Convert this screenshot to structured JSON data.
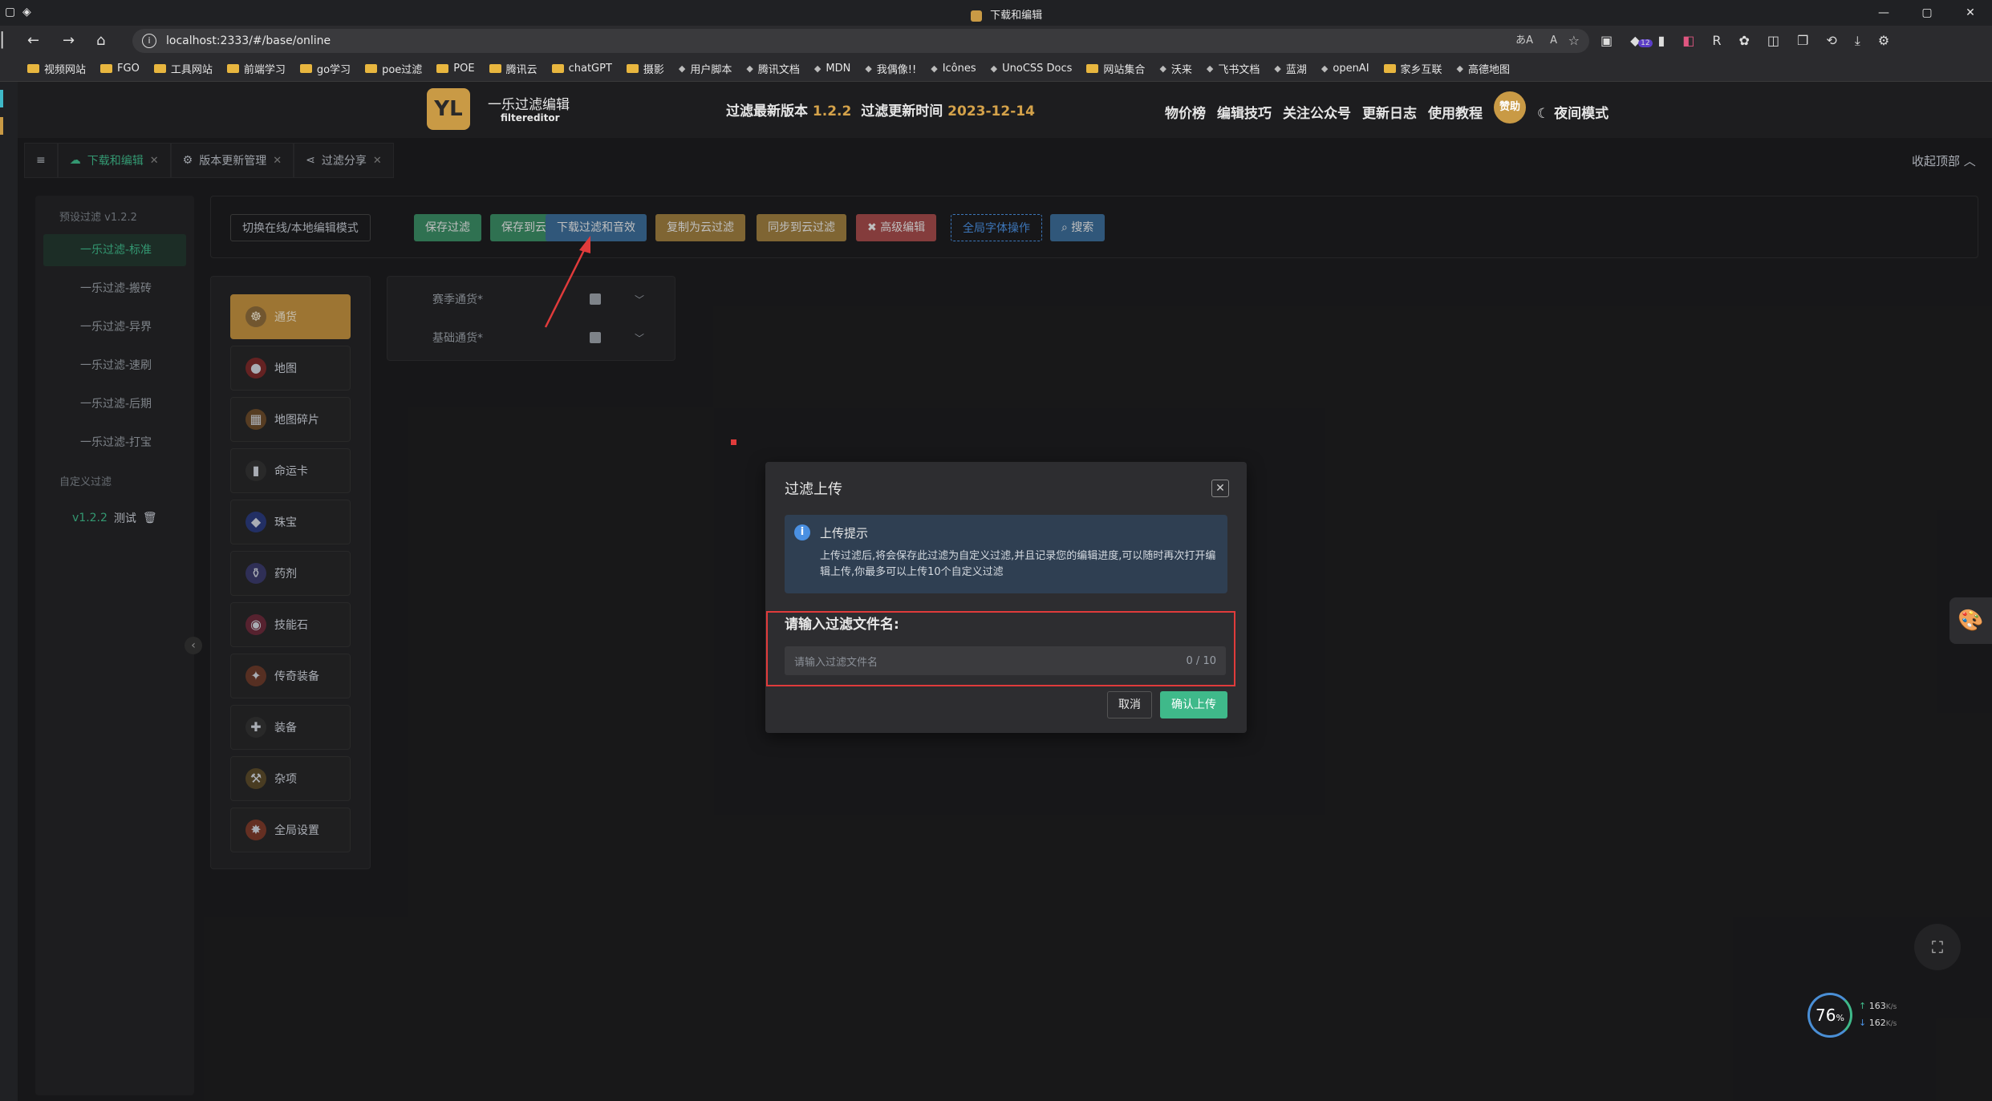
{
  "window": {
    "title": "下载和编辑",
    "controls": [
      "—",
      "▢",
      "✕"
    ]
  },
  "browser": {
    "url": "localhost:2333/#/base/online",
    "ext_badge": "12"
  },
  "bookmarks": [
    {
      "label": "视频网站",
      "type": "folder"
    },
    {
      "label": "FGO",
      "type": "folder"
    },
    {
      "label": "工具网站",
      "type": "folder"
    },
    {
      "label": "前端学习",
      "type": "folder"
    },
    {
      "label": "go学习",
      "type": "folder"
    },
    {
      "label": "poe过滤",
      "type": "folder"
    },
    {
      "label": "POE",
      "type": "folder"
    },
    {
      "label": "腾讯云",
      "type": "folder"
    },
    {
      "label": "chatGPT",
      "type": "folder"
    },
    {
      "label": "摄影",
      "type": "folder"
    },
    {
      "label": "用户脚本",
      "type": "link"
    },
    {
      "label": "腾讯文档",
      "type": "link"
    },
    {
      "label": "MDN",
      "type": "link"
    },
    {
      "label": "我偶像!!",
      "type": "link"
    },
    {
      "label": "Icônes",
      "type": "link"
    },
    {
      "label": "UnoCSS Docs",
      "type": "link"
    },
    {
      "label": "网站集合",
      "type": "folder"
    },
    {
      "label": "沃来",
      "type": "link"
    },
    {
      "label": "飞书文档",
      "type": "link"
    },
    {
      "label": "蓝湖",
      "type": "link"
    },
    {
      "label": "openAI",
      "type": "link"
    },
    {
      "label": "家乡互联",
      "type": "folder"
    },
    {
      "label": "高德地图",
      "type": "link"
    }
  ],
  "header": {
    "logo": "YL",
    "brand": "一乐过滤编辑",
    "brand_sub": "filtereditor",
    "version_label": "过滤最新版本",
    "version": "1.2.2",
    "update_label": "过滤更新时间",
    "update_date": "2023-12-14",
    "nav": [
      "物价榜",
      "编辑技巧",
      "关注公众号",
      "更新日志",
      "使用教程"
    ],
    "sponsor": "赞助",
    "night_mode": "夜间模式"
  },
  "tabs": [
    {
      "label": "下载和编辑",
      "active": true
    },
    {
      "label": "版本更新管理",
      "active": false
    },
    {
      "label": "过滤分享",
      "active": false
    }
  ],
  "collapse_top": "收起顶部",
  "sidebar": {
    "preset_group": "预设过滤 v1.2.2",
    "items": [
      "一乐过滤-标准",
      "一乐过滤-搬砖",
      "一乐过滤-异界",
      "一乐过滤-速刷",
      "一乐过滤-后期",
      "一乐过滤-打宝"
    ],
    "custom_group": "自定义过滤",
    "custom_version": "v1.2.2",
    "custom_name": "测试"
  },
  "toolbar": {
    "switch_mode": "切换在线/本地编辑模式",
    "save": "保存过滤",
    "save_cloud": "保存到云端",
    "download": "下载过滤和音效",
    "copy_cloud": "复制为云过滤",
    "sync_cloud": "同步到云过滤",
    "advanced": "高级编辑",
    "font_ops": "全局字体操作",
    "search": "搜索"
  },
  "categories": [
    "通货",
    "地图",
    "地图碎片",
    "命运卡",
    "珠宝",
    "药剂",
    "技能石",
    "传奇装备",
    "装备",
    "杂项",
    "全局设置"
  ],
  "item_rows": [
    "赛季通货*",
    "基础通货*"
  ],
  "dialog": {
    "title": "过滤上传",
    "alert_title": "上传提示",
    "alert_desc": "上传过滤后,将会保存此过滤为自定义过滤,并且记录您的编辑进度,可以随时再次打开编辑上传,你最多可以上传10个自定义过滤",
    "field_label": "请输入过滤文件名:",
    "placeholder": "请输入过滤文件名",
    "counter": "0 / 10",
    "cancel": "取消",
    "confirm": "确认上传"
  },
  "network": {
    "percent": "76",
    "unit": "%",
    "up": "163",
    "down": "162",
    "speed_unit": "K/s"
  },
  "colors": {
    "accent": "#3fb98a",
    "gold": "#c99a45",
    "annotation_red": "#e03b3b"
  }
}
